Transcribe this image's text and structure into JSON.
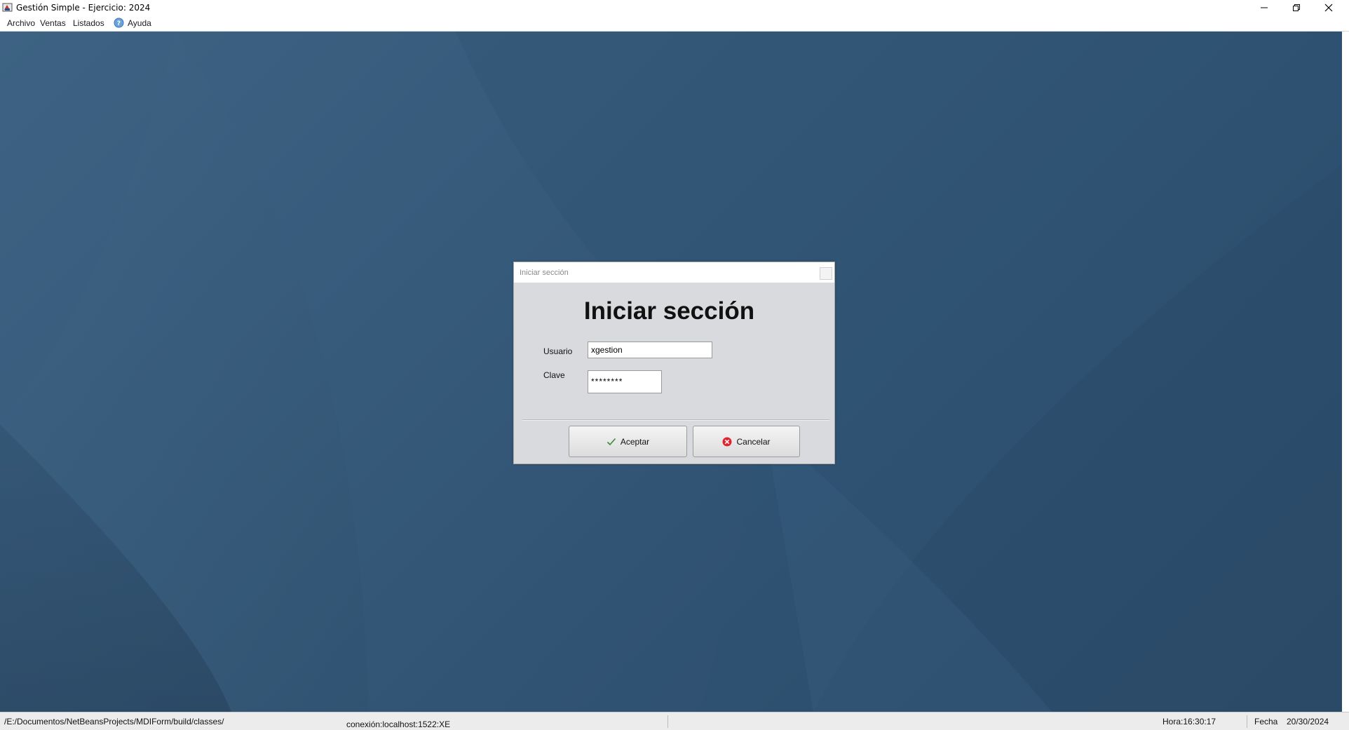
{
  "window": {
    "title": "Gestión Simple - Ejercicio: 2024"
  },
  "menu": {
    "items": [
      "Archivo",
      "Ventas",
      "Listados",
      "Ayuda"
    ]
  },
  "dialog": {
    "title": "Iniciar sección",
    "heading": "Iniciar sección",
    "usuario_label": "Usuario",
    "usuario_value": "xgestion",
    "clave_label": "Clave",
    "clave_value": "********",
    "aceptar_label": "Aceptar",
    "cancelar_label": "Cancelar"
  },
  "statusbar": {
    "path": "/E:/Documentos/NetBeansProjects/MDIForm/build/classes/",
    "connection": "conexión:localhost:1522:XE",
    "hora": "Hora:16:30:17",
    "fecha_label": "Fecha",
    "fecha_value": "20/30/2024"
  },
  "colors": {
    "desktop": "#365a7a",
    "dialog_bg": "#d9dadd",
    "accept_icon": "#3a8a3a",
    "cancel_icon": "#e0242f",
    "help_icon": "#6aa3dc"
  },
  "icons": {
    "app": "app-icon",
    "help": "help-icon",
    "accept": "check-icon",
    "cancel": "cancel-icon"
  }
}
